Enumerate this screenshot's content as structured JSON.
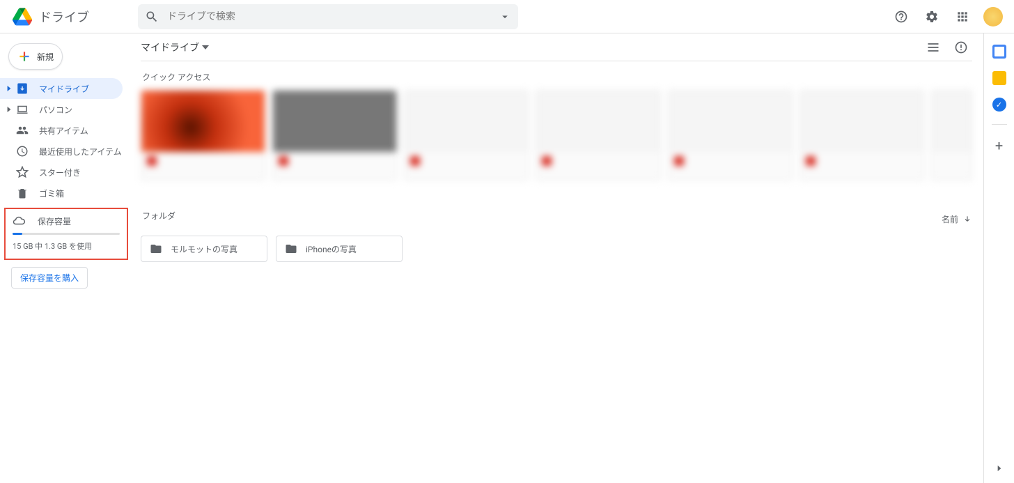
{
  "header": {
    "product_name": "ドライブ",
    "search_placeholder": "ドライブで検索"
  },
  "sidebar": {
    "new_button": "新規",
    "items": [
      {
        "label": "マイドライブ"
      },
      {
        "label": "パソコン"
      },
      {
        "label": "共有アイテム"
      },
      {
        "label": "最近使用したアイテム"
      },
      {
        "label": "スター付き"
      },
      {
        "label": "ゴミ箱"
      }
    ],
    "storage": {
      "label": "保存容量",
      "usage_text": "15 GB 中 1.3 GB を使用",
      "buy_label": "保存容量を購入"
    }
  },
  "main": {
    "path": "マイドライブ",
    "quick_access_title": "クイック アクセス",
    "folders_title": "フォルダ",
    "sort_label": "名前",
    "folders": [
      {
        "name": "モルモットの写真"
      },
      {
        "name": "iPhoneの写真"
      }
    ]
  }
}
